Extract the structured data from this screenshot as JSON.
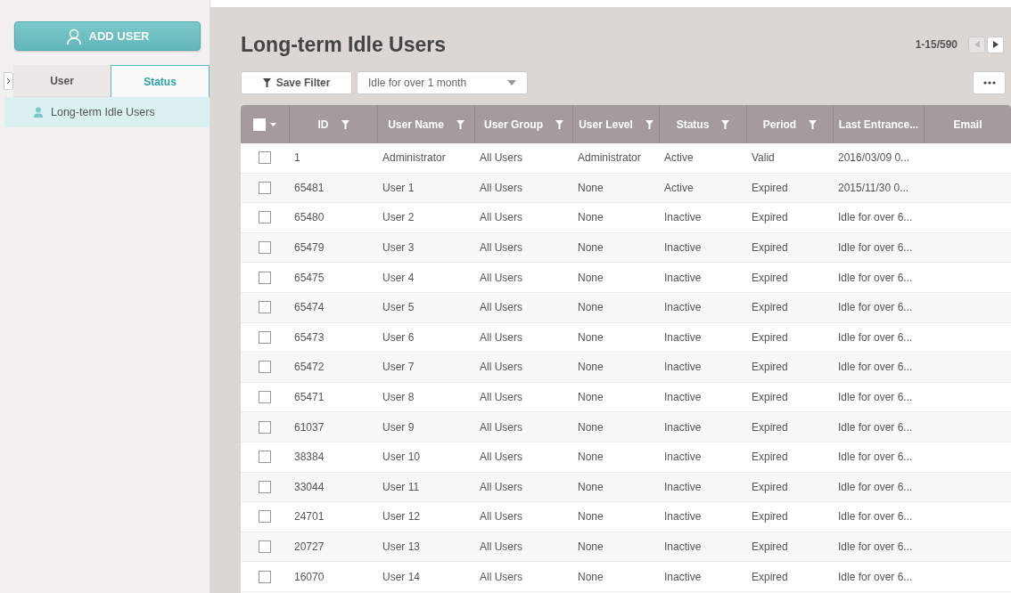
{
  "sidebar": {
    "add_button": "ADD USER",
    "tabs": [
      {
        "label": "User",
        "selected": false
      },
      {
        "label": "Status",
        "selected": true
      }
    ],
    "items": [
      {
        "label": "Long-term Idle Users",
        "selected": true
      }
    ]
  },
  "main": {
    "title": "Long-term Idle Users",
    "pagination": {
      "range": "1-15/590",
      "prev_disabled": true,
      "next_disabled": false
    },
    "save_filter": "Save Filter",
    "filter_select": "Idle for over 1 month",
    "table": {
      "select_all_checked": false,
      "columns": [
        {
          "label": "ID",
          "filter": true
        },
        {
          "label": "User Name",
          "filter": true
        },
        {
          "label": "User Group",
          "filter": true
        },
        {
          "label": "User Level",
          "filter": true
        },
        {
          "label": "Status",
          "filter": true
        },
        {
          "label": "Period",
          "filter": true
        },
        {
          "label": "Last Entrance...",
          "filter": false
        },
        {
          "label": "Email",
          "filter": false
        }
      ],
      "rows": [
        {
          "checked": false,
          "cells": [
            "1",
            "Administrator",
            "All Users",
            "Administrator",
            "Active",
            "Valid",
            "2016/03/09 0..."
          ]
        },
        {
          "checked": false,
          "cells": [
            "65481",
            "User 1",
            "All Users",
            "None",
            "Active",
            "Expired",
            "2015/11/30 0..."
          ]
        },
        {
          "checked": false,
          "cells": [
            "65480",
            "User 2",
            "All Users",
            "None",
            "Inactive",
            "Expired",
            "Idle for over 6..."
          ]
        },
        {
          "checked": false,
          "cells": [
            "65479",
            "User 3",
            "All Users",
            "None",
            "Inactive",
            "Expired",
            "Idle for over 6..."
          ]
        },
        {
          "checked": false,
          "cells": [
            "65475",
            "User 4",
            "All Users",
            "None",
            "Inactive",
            "Expired",
            "Idle for over 6..."
          ]
        },
        {
          "checked": false,
          "cells": [
            "65474",
            "User 5",
            "All Users",
            "None",
            "Inactive",
            "Expired",
            "Idle for over 6..."
          ]
        },
        {
          "checked": false,
          "cells": [
            "65473",
            "User 6",
            "All Users",
            "None",
            "Inactive",
            "Expired",
            "Idle for over 6..."
          ]
        },
        {
          "checked": false,
          "cells": [
            "65472",
            "User 7",
            "All Users",
            "None",
            "Inactive",
            "Expired",
            "Idle for over 6..."
          ]
        },
        {
          "checked": false,
          "cells": [
            "65471",
            "User 8",
            "All Users",
            "None",
            "Inactive",
            "Expired",
            "Idle for over 6..."
          ]
        },
        {
          "checked": false,
          "cells": [
            "61037",
            "User 9",
            "All Users",
            "None",
            "Inactive",
            "Expired",
            "Idle for over 6..."
          ]
        },
        {
          "checked": false,
          "cells": [
            "38384",
            "User 10",
            "All Users",
            "None",
            "Inactive",
            "Expired",
            "Idle for over 6..."
          ]
        },
        {
          "checked": false,
          "cells": [
            "33044",
            "User 11",
            "All Users",
            "None",
            "Inactive",
            "Expired",
            "Idle for over 6..."
          ]
        },
        {
          "checked": false,
          "cells": [
            "24701",
            "User 12",
            "All Users",
            "None",
            "Inactive",
            "Expired",
            "Idle for over 6..."
          ]
        },
        {
          "checked": false,
          "cells": [
            "20727",
            "User 13",
            "All Users",
            "None",
            "Inactive",
            "Expired",
            "Idle for over 6..."
          ]
        },
        {
          "checked": false,
          "cells": [
            "16070",
            "User 14",
            "All Users",
            "None",
            "Inactive",
            "Expired",
            "Idle for over 6..."
          ]
        }
      ]
    }
  }
}
